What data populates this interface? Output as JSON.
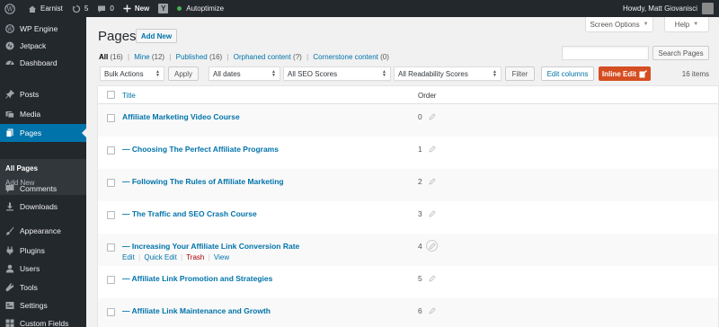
{
  "adminbar": {
    "site_name": "Earnist",
    "updates_count": "5",
    "comments_count": "0",
    "new_label": "New",
    "yoast_label": "Y",
    "autoptimize_label": "Autoptimize",
    "howdy": "Howdy, Matt Giovanisci"
  },
  "sidebar": {
    "items": [
      {
        "label": "WP Engine",
        "icon": "wp-engine-icon"
      },
      {
        "label": "Jetpack",
        "icon": "jetpack-icon"
      },
      {
        "label": "Dashboard",
        "icon": "dashboard-icon"
      },
      {
        "label": "Posts",
        "icon": "pushpin-icon"
      },
      {
        "label": "Media",
        "icon": "media-icon"
      },
      {
        "label": "Pages",
        "icon": "pages-icon"
      },
      {
        "label": "Comments",
        "icon": "comments-icon"
      },
      {
        "label": "Downloads",
        "icon": "download-icon"
      },
      {
        "label": "Appearance",
        "icon": "paintbrush-icon"
      },
      {
        "label": "Plugins",
        "icon": "plugin-icon"
      },
      {
        "label": "Users",
        "icon": "users-icon"
      },
      {
        "label": "Tools",
        "icon": "wrench-icon"
      },
      {
        "label": "Settings",
        "icon": "settings-icon"
      },
      {
        "label": "Custom Fields",
        "icon": "custom-fields-icon"
      }
    ],
    "submenu": {
      "all_pages": "All Pages",
      "add_new": "Add New"
    }
  },
  "header": {
    "title": "Pages",
    "add_new": "Add New",
    "screen_options": "Screen Options",
    "help": "Help"
  },
  "filters": {
    "all": "All",
    "all_count": "(16)",
    "mine": "Mine",
    "mine_count": "(12)",
    "published": "Published",
    "published_count": "(16)",
    "orphaned": "Orphaned content",
    "orphaned_count": "(?)",
    "cornerstone": "Cornerstone content",
    "cornerstone_count": "(0)",
    "separator": "|"
  },
  "search": {
    "button": "Search Pages",
    "placeholder": ""
  },
  "toolbar": {
    "bulk_actions": "Bulk Actions",
    "apply": "Apply",
    "all_dates": "All dates",
    "seo_scores": "All SEO Scores",
    "readability_scores": "All Readability Scores",
    "filter": "Filter",
    "edit_columns": "Edit columns",
    "inline_edit": "Inline Edit",
    "items_count": "16 items"
  },
  "table": {
    "columns": {
      "title": "Title",
      "order": "Order"
    },
    "rows": [
      {
        "title": "Affiliate Marketing Video Course",
        "order": "0"
      },
      {
        "title": "— Choosing The Perfect Affiliate Programs",
        "order": "1"
      },
      {
        "title": "— Following The Rules of Affiliate Marketing",
        "order": "2"
      },
      {
        "title": "— The Traffic and SEO Crash Course",
        "order": "3"
      },
      {
        "title": "— Increasing Your Affiliate Link Conversion Rate",
        "order": "4"
      },
      {
        "title": "— Affiliate Link Promotion and Strategies",
        "order": "5"
      },
      {
        "title": "— Affiliate Link Maintenance and Growth",
        "order": "6"
      }
    ],
    "row_actions": {
      "edit": "Edit",
      "quick_edit": "Quick Edit",
      "trash": "Trash",
      "view": "View",
      "pipe": "|"
    }
  }
}
